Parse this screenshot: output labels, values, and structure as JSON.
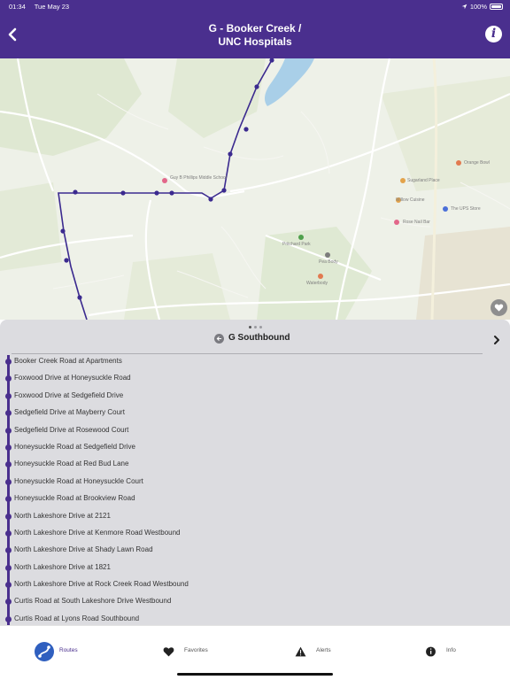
{
  "status_bar": {
    "time": "01:34",
    "date": "Tue May 23",
    "battery": "100%"
  },
  "header": {
    "title_line1": "G - Booker Creek /",
    "title_line2": "UNC Hospitals",
    "back_icon": "chevron-left-icon",
    "info_icon": "info-icon"
  },
  "map": {
    "labels": {
      "park": "Pritchard Park",
      "school": "Guy B Phillips Middle School",
      "pea_body": "Pea Body",
      "waterbody": "Waterbody",
      "ups_store": "The UPS Store",
      "rose": "Rose Nail Bar",
      "willow": "Willow Cuisine",
      "orange": "Orange Bowl",
      "sugarland": "Sugarland Place"
    },
    "route_color": "#3b2a8f"
  },
  "panel": {
    "direction": "G Southbound",
    "page_count": 3,
    "active_page": 1,
    "stops": [
      "Booker Creek Road at Apartments",
      "Foxwood Drive at Honeysuckle Road",
      "Foxwood Drive at Sedgefield Drive",
      "Sedgefield Drive at Mayberry Court",
      "Sedgefield Drive at Rosewood Court",
      "Honeysuckle Road at Sedgefield Drive",
      "Honeysuckle Road at Red Bud Lane",
      "Honeysuckle Road at Honeysuckle Court",
      "Honeysuckle Road at Brookview Road",
      "North Lakeshore Drive at 2121",
      "North Lakeshore Drive at Kenmore Road Westbound",
      "North Lakeshore Drive at Shady Lawn Road",
      "North Lakeshore Drive at 1821",
      "North Lakeshore Drive at Rock Creek Road Westbound",
      "Curtis Road at South Lakeshore Drive Westbound",
      "Curtis Road at Lyons Road Southbound"
    ]
  },
  "tabs": {
    "routes": "Routes",
    "favorites": "Favorites",
    "alerts": "Alerts",
    "info": "Info"
  },
  "colors": {
    "brand": "#4a2f8e",
    "panel_bg": "#dcdce0",
    "routes_tab": "#2f5fbf"
  }
}
